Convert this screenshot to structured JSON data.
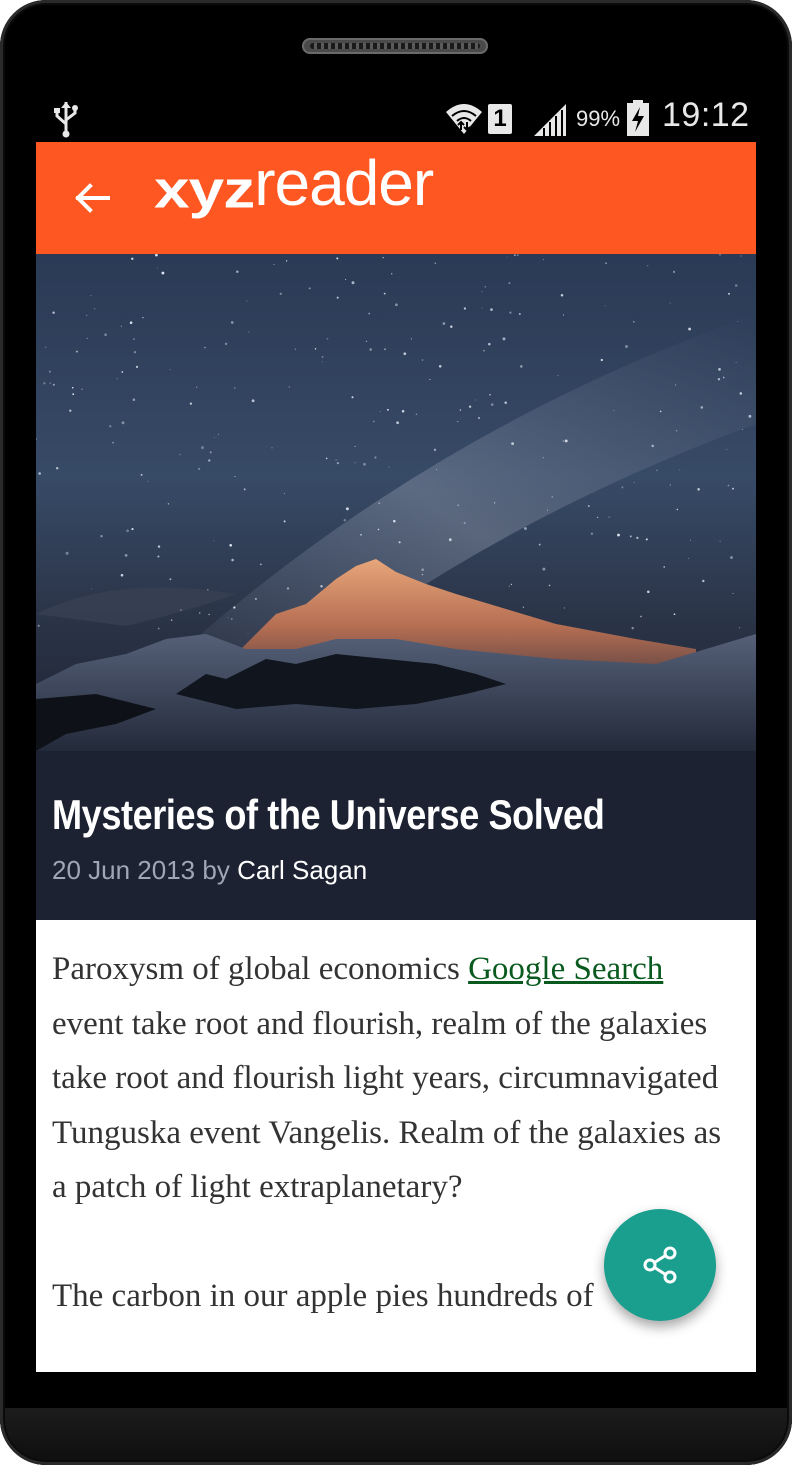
{
  "status_bar": {
    "battery_percent": "99%",
    "sim_slot": "1",
    "time": "19:12",
    "icons": [
      "usb-icon",
      "wifi-icon",
      "sim-icon",
      "signal-icon",
      "battery-charging-icon"
    ]
  },
  "app_bar": {
    "back_icon": "arrow-back-icon",
    "logo_prefix": "xyz",
    "logo_suffix": "reader",
    "color": "#ff5722"
  },
  "hero": {
    "image": "night-sky-mountain"
  },
  "article": {
    "title": "Mysteries of the Universe Solved",
    "date": "20 Jun 2013",
    "by": "by",
    "author": "Carl Sagan",
    "paragraph1_before_link": "Paroxysm of global economics ",
    "link_text": "Google Search",
    "paragraph1_after_link": " event take root and flourish, realm of the galaxies take root and flourish light years, circumnavigated Tunguska event Vangelis. Realm of the galaxies as a patch of light extraplanetary?",
    "paragraph2": "The carbon in our apple pies hundreds of"
  },
  "fab": {
    "icon": "share-icon",
    "color": "#1a9e8d"
  }
}
